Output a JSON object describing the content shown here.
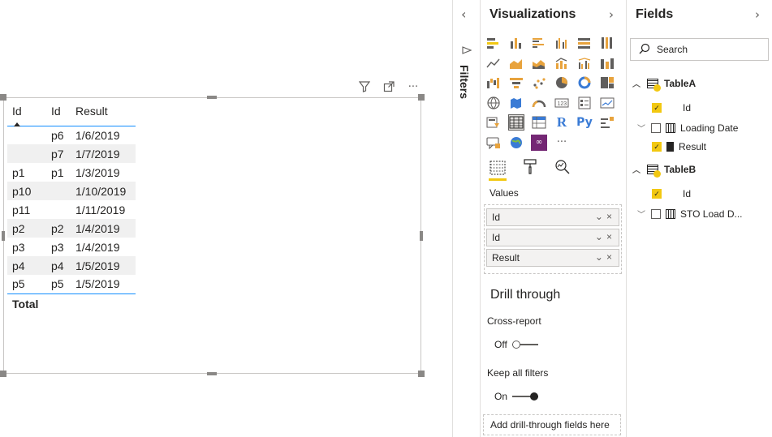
{
  "table": {
    "headers": [
      "Id",
      "Id",
      "Result"
    ],
    "rows": [
      [
        "",
        "p6",
        "1/6/2019"
      ],
      [
        "",
        "p7",
        "1/7/2019"
      ],
      [
        "p1",
        "p1",
        "1/3/2019"
      ],
      [
        "p10",
        "",
        "1/10/2019"
      ],
      [
        "p11",
        "",
        "1/11/2019"
      ],
      [
        "p2",
        "p2",
        "1/4/2019"
      ],
      [
        "p3",
        "p3",
        "1/4/2019"
      ],
      [
        "p4",
        "p4",
        "1/5/2019"
      ],
      [
        "p5",
        "p5",
        "1/5/2019"
      ]
    ],
    "total_label": "Total"
  },
  "visual_header": {
    "more_label": "···"
  },
  "filters": {
    "label": "Filters"
  },
  "visualizations": {
    "title": "Visualizations",
    "icon_r": "R",
    "icon_py": "Py",
    "more_label": "···",
    "values_label": "Values",
    "value_fields": [
      "Id",
      "Id",
      "Result"
    ],
    "drill_through_title": "Drill through",
    "cross_report_label": "Cross-report",
    "cross_report_state": "Off",
    "keep_filters_label": "Keep all filters",
    "keep_filters_state": "On",
    "add_drill_label": "Add drill-through fields here"
  },
  "fields": {
    "title": "Fields",
    "search_placeholder": "Search",
    "tableA": {
      "name": "TableA",
      "fields": [
        "Id",
        "Loading Date",
        "Result"
      ]
    },
    "tableB": {
      "name": "TableB",
      "fields": [
        "Id",
        "STO Load D..."
      ]
    }
  },
  "colors": {
    "accent": "#f2c811",
    "table_rule": "#118dff",
    "purple_visual": "#742774"
  }
}
